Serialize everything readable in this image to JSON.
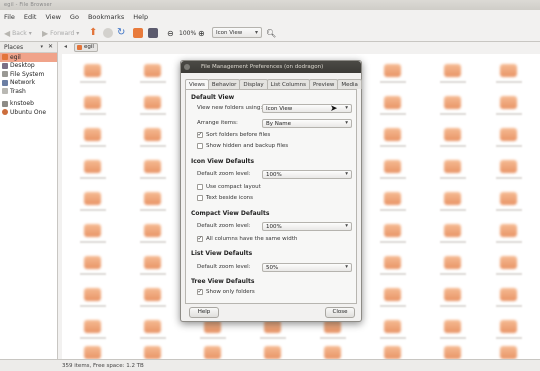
{
  "window": {
    "title": "egil - File Browser"
  },
  "menubar": [
    "File",
    "Edit",
    "View",
    "Go",
    "Bookmarks",
    "Help"
  ],
  "toolbar": {
    "back": "Back",
    "forward": "Forward",
    "zoom": "100%",
    "view_mode": "Icon View"
  },
  "sidepane": {
    "header": "Places",
    "items": [
      {
        "label": "egil",
        "icon": "home-icon",
        "selected": true
      },
      {
        "label": "Desktop",
        "icon": "desktop-icon"
      },
      {
        "label": "File System",
        "icon": "drive-icon"
      },
      {
        "label": "Network",
        "icon": "network-icon"
      },
      {
        "label": "Trash",
        "icon": "trash-icon"
      },
      {
        "label": "knstoeb",
        "icon": "drive-icon"
      },
      {
        "label": "Ubuntu One",
        "icon": "cloud-icon"
      }
    ]
  },
  "pathbar": {
    "current": "egil"
  },
  "statusbar": {
    "text": "359 items, Free space: 1.2 TB"
  },
  "dialog": {
    "title": "File Management Preferences (on dodragon)",
    "tabs": [
      "Views",
      "Behavior",
      "Display",
      "List Columns",
      "Preview",
      "Media"
    ],
    "default_view": {
      "heading": "Default View",
      "new_folders_label": "View new folders using:",
      "new_folders_value": "Icon View",
      "arrange_label": "Arrange items:",
      "arrange_value": "By Name",
      "sort_folders": "Sort folders before files",
      "show_hidden": "Show hidden and backup files"
    },
    "icon_view": {
      "heading": "Icon View Defaults",
      "zoom_label": "Default zoom level:",
      "zoom_value": "100%",
      "compact": "Use compact layout",
      "text_beside": "Text beside icons"
    },
    "compact_view": {
      "heading": "Compact View Defaults",
      "zoom_label": "Default zoom level:",
      "zoom_value": "100%",
      "same_width": "All columns have the same width"
    },
    "list_view": {
      "heading": "List View Defaults",
      "zoom_label": "Default zoom level:",
      "zoom_value": "50%"
    },
    "tree_view": {
      "heading": "Tree View Defaults",
      "only_folders": "Show only folders"
    },
    "help_label": "Help",
    "close_label": "Close"
  }
}
